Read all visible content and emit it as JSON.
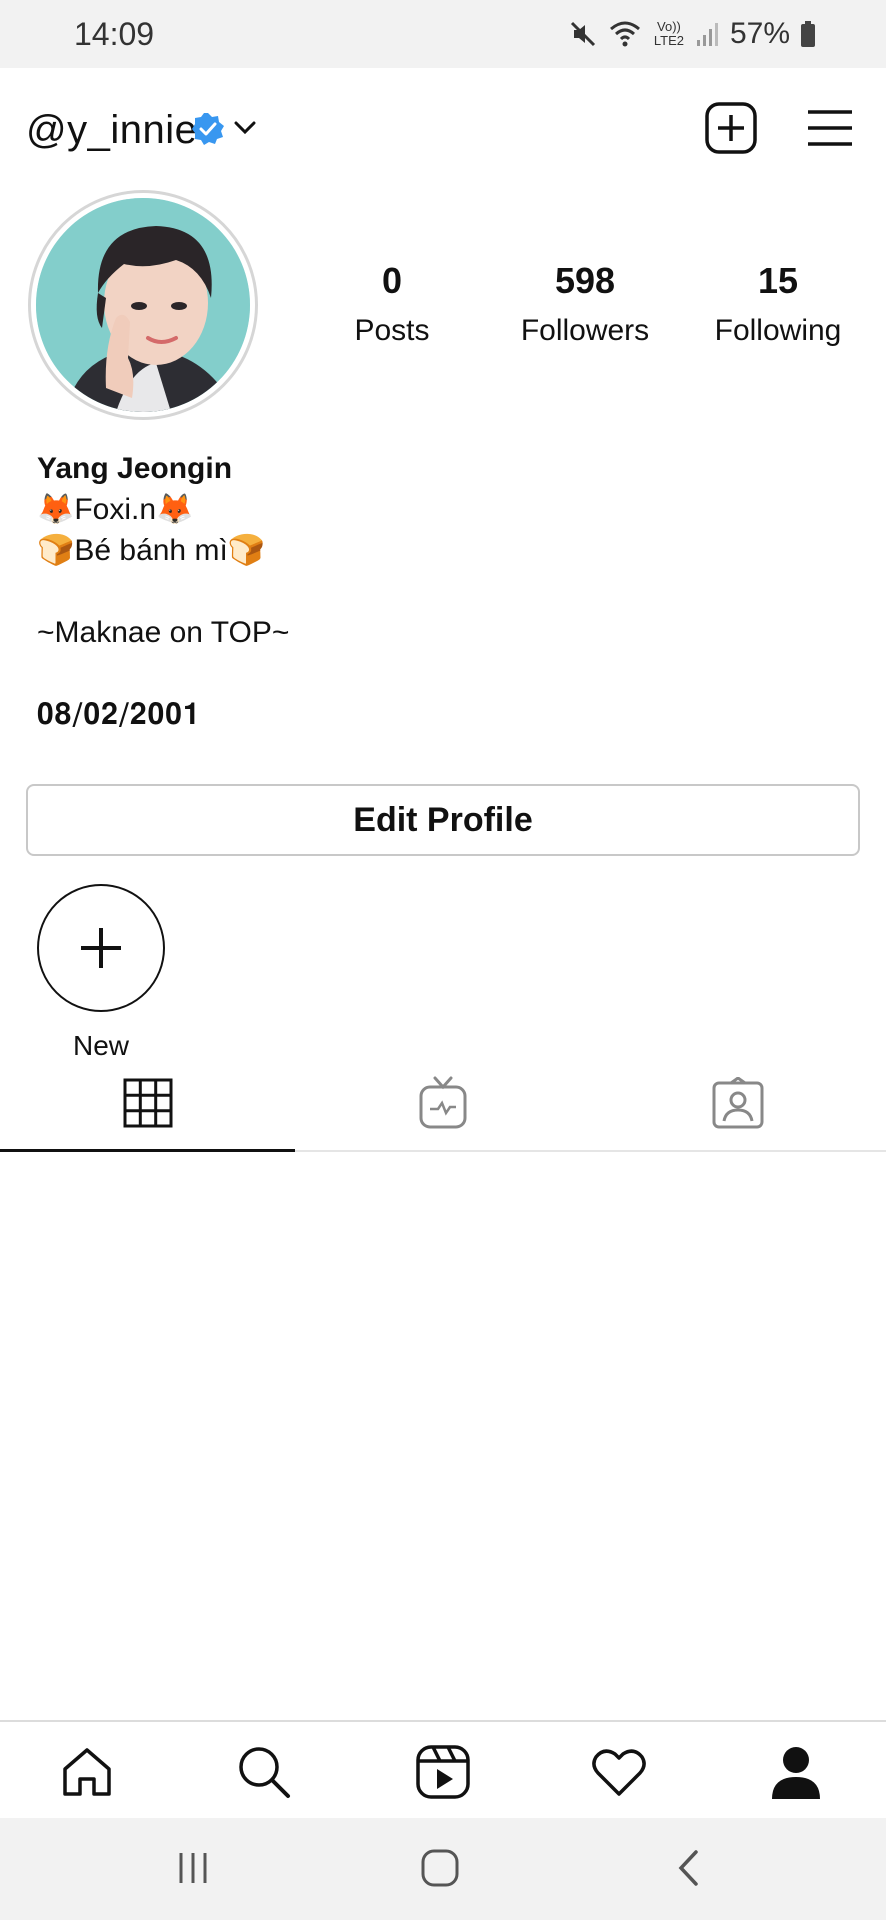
{
  "status_bar": {
    "time": "14:09",
    "network_label": "Vo)) LTE2",
    "battery": "57%"
  },
  "header": {
    "username": "@y_innie",
    "icons": [
      "verified-badge-icon",
      "chevron-down-icon",
      "new-post-icon",
      "menu-icon"
    ]
  },
  "profile": {
    "stats": [
      {
        "value": "0",
        "label": "Posts"
      },
      {
        "value": "598",
        "label": "Followers"
      },
      {
        "value": "15",
        "label": "Following"
      }
    ],
    "display_name": "Yang Jeongin",
    "bio_lines": [
      "🦊Foxi.n🦊",
      "🍞Bé bánh mì🍞",
      "",
      "~Maknae on TOP~",
      "",
      "𝟎𝟖/𝟎𝟐/𝟐𝟎𝟎𝟏"
    ],
    "edit_button": "Edit Profile"
  },
  "highlights": {
    "new_label": "New"
  },
  "tabs": [
    {
      "name": "grid",
      "icon": "grid-icon",
      "active": true
    },
    {
      "name": "igtv",
      "icon": "igtv-icon",
      "active": false
    },
    {
      "name": "tagged",
      "icon": "tagged-icon",
      "active": false
    }
  ],
  "bottom_nav": [
    "home-icon",
    "search-icon",
    "reels-icon",
    "heart-icon",
    "profile-icon"
  ],
  "colors": {
    "verified_blue": "#3897f0",
    "text": "#111111",
    "border": "#c8c8c8",
    "status_bg": "#f2f2f2"
  }
}
